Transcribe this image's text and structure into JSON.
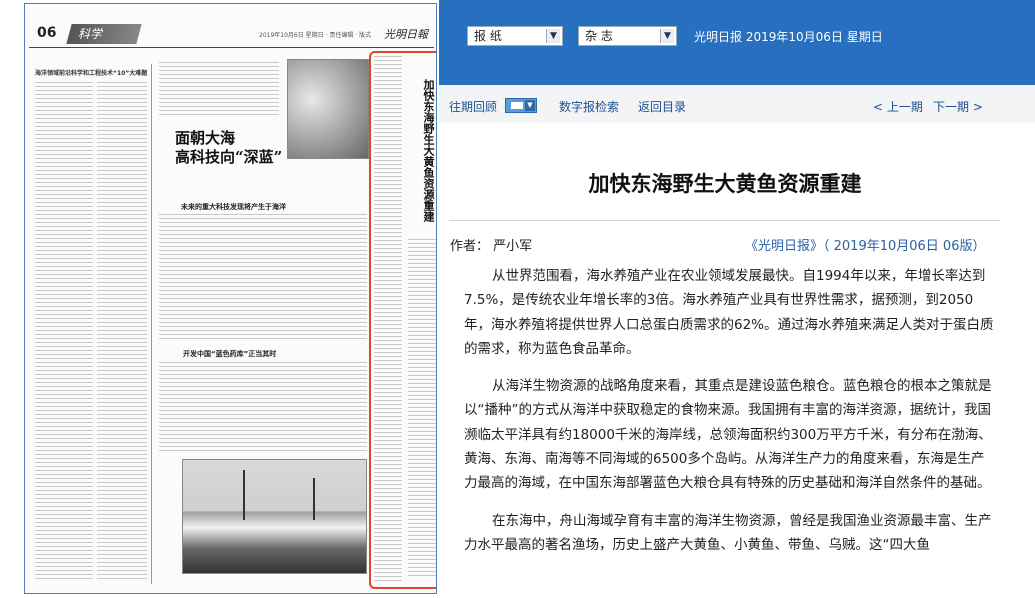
{
  "paper": {
    "page_number": "06",
    "section": "科学",
    "logo": "光明日報",
    "date_line": "2019年10月6日 星期日 · 责任编辑 · 版式",
    "left_banner": "海洋领域前沿科学和工程技术“10”大难题",
    "main_headline": "面朝大海\n高科技向“深蓝”",
    "sub_headline": "未来的重大科技发现将产生于海洋",
    "second_headline": "开发中国“蓝色药库”正当其时",
    "highlighted_article_title": "加快东海野生大黄鱼资源重建"
  },
  "toolbar": {
    "select_newspaper": "报 纸",
    "select_magazine": "杂 志",
    "issue_info": "光明日报 2019年10月06日 星期日"
  },
  "nav": {
    "past_issues": "往期回顾",
    "digital_search": "数字报检索",
    "back_to_index": "返回目录",
    "prev_page": "< 上一期",
    "next_page": "下一期 >"
  },
  "article": {
    "title": "加快东海野生大黄鱼资源重建",
    "author": "作者：  严小军",
    "source": "《光明日报》（ 2019年10月06日 06版）",
    "paragraphs": [
      "从世界范围看，海水养殖产业在农业领域发展最快。自1994年以来，年增长率达到7.5%，是传统农业年增长率的3倍。海水养殖产业具有世界性需求，据预测，到2050年，海水养殖将提供世界人口总蛋白质需求的62%。通过海水养殖来满足人类对于蛋白质的需求，称为蓝色食品革命。",
      "从海洋生物资源的战略角度来看，其重点是建设蓝色粮仓。蓝色粮仓的根本之策就是以“播种”的方式从海洋中获取稳定的食物来源。我国拥有丰富的海洋资源，据统计，我国濒临太平洋具有约18000千米的海岸线，总领海面积约300万平方千米，有分布在渤海、黄海、东海、南海等不同海域的6500多个岛屿。从海洋生产力的角度来看，东海是生产力最高的海域，在中国东海部署蓝色大粮仓具有特殊的历史基础和海洋自然条件的基础。",
      "在东海中，舟山海域孕育有丰富的海洋生物资源，曾经是我国渔业资源最丰富、生产力水平最高的著名渔场，历史上盛产大黄鱼、小黄鱼、带鱼、乌贼。这“四大鱼"
    ]
  }
}
